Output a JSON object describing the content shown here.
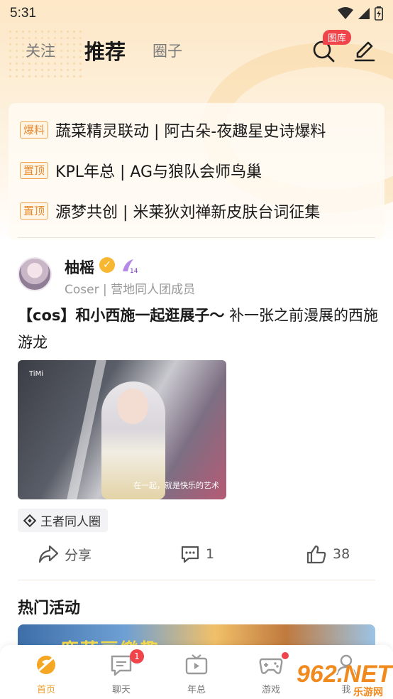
{
  "status_bar": {
    "time": "5:31"
  },
  "header": {
    "tabs": [
      {
        "label": "关注"
      },
      {
        "label": "推荐"
      },
      {
        "label": "圈子"
      }
    ],
    "gallery_badge": "图库"
  },
  "news": [
    {
      "tag": "爆料",
      "text": "蔬菜精灵联动 | 阿古朵-夜趣星史诗爆料"
    },
    {
      "tag": "置顶",
      "text": "KPL年总 | AG与狼队会师鸟巢"
    },
    {
      "tag": "置顶",
      "text": "源梦共创 | 米莱狄刘禅新皮肤台词征集"
    }
  ],
  "post": {
    "username": "柚榣",
    "level_badge": "14",
    "subtitle": "Coser | 营地同人团成员",
    "title_bold": "【cos】和小西施一起逛展子～",
    "title_rest": "补一张之前漫展的西施游龙",
    "image_brand": "TiMi",
    "image_caption": "在一起，就是快乐的艺术",
    "circle": "王者同人圈",
    "share_label": "分享",
    "comment_count": "1",
    "like_count": "38"
  },
  "hot": {
    "title": "热门活动",
    "banner_text": "鹿蔬豆樂趣"
  },
  "bottom_nav": [
    {
      "label": "首页",
      "active": true
    },
    {
      "label": "聊天",
      "badge": "1"
    },
    {
      "label": "年总"
    },
    {
      "label": "游戏",
      "dot": true
    },
    {
      "label": "我"
    }
  ],
  "watermark": {
    "main": "962.NET",
    "sub": "乐游网"
  },
  "colors": {
    "accent": "#f8c24d",
    "badge_red": "#f0434a",
    "tag_orange": "#e8892e"
  }
}
